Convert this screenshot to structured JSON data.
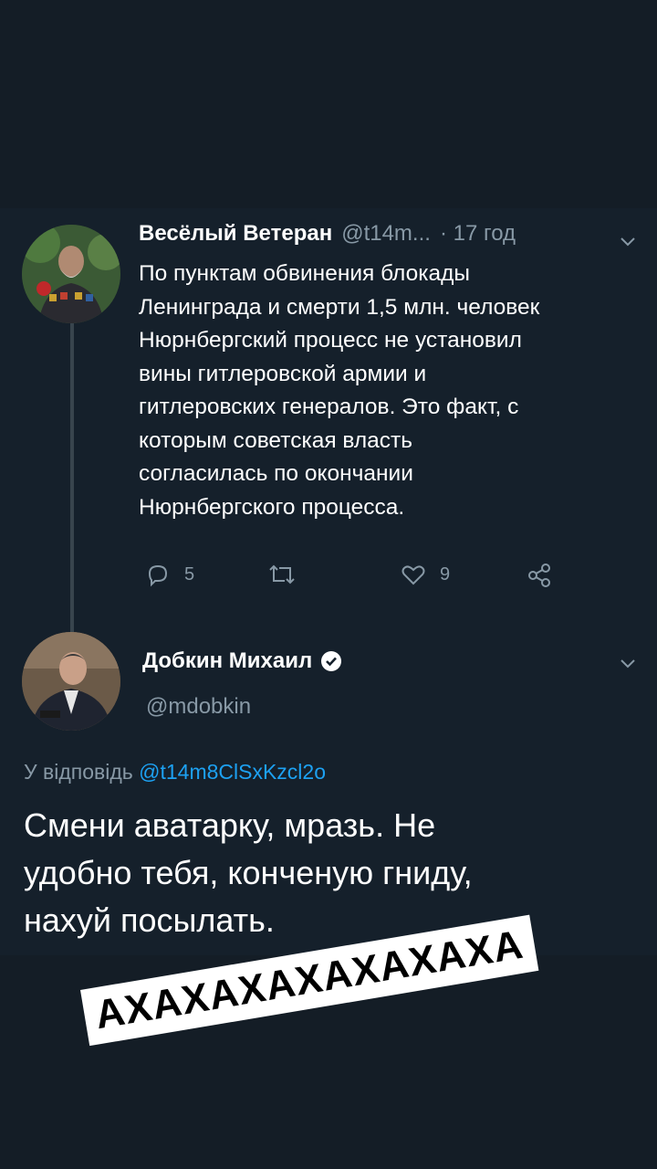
{
  "tweet1": {
    "name": "Весёлый Ветеран",
    "handle": "@t14m...",
    "time": "· 17 год",
    "lines": [
      "По пунктам обвинения блокады",
      "Ленинграда и смерти 1,5 млн. человек",
      "Нюрнбергский процесс не установил",
      "вины гитлеровской армии и",
      "гитлеровских генералов. Это факт, с",
      "которым советская власть",
      "согласилась по окончании",
      "Нюрнбергского процесса."
    ],
    "replies": "5",
    "likes": "9"
  },
  "tweet2": {
    "name": "Добкин Михаил",
    "handle": "@mdobkin",
    "reply_prefix": "У відповідь",
    "reply_handle": "@t14m8ClSxKzcl2o",
    "lines": [
      "Смени аватарку, мразь. Не",
      "удобно тебя, конченую гниду,",
      "нахуй посылать."
    ]
  },
  "caption": "АХАХАХАХАХАХАХА",
  "colors": {
    "background": "#141d26",
    "text": "#ffffff",
    "secondary": "#8899a6",
    "link": "#1da1f2",
    "verified": "#ffffff"
  },
  "icons": [
    "chevron-down-icon",
    "reply-icon",
    "retweet-icon",
    "like-icon",
    "share-icon",
    "verified-icon"
  ]
}
